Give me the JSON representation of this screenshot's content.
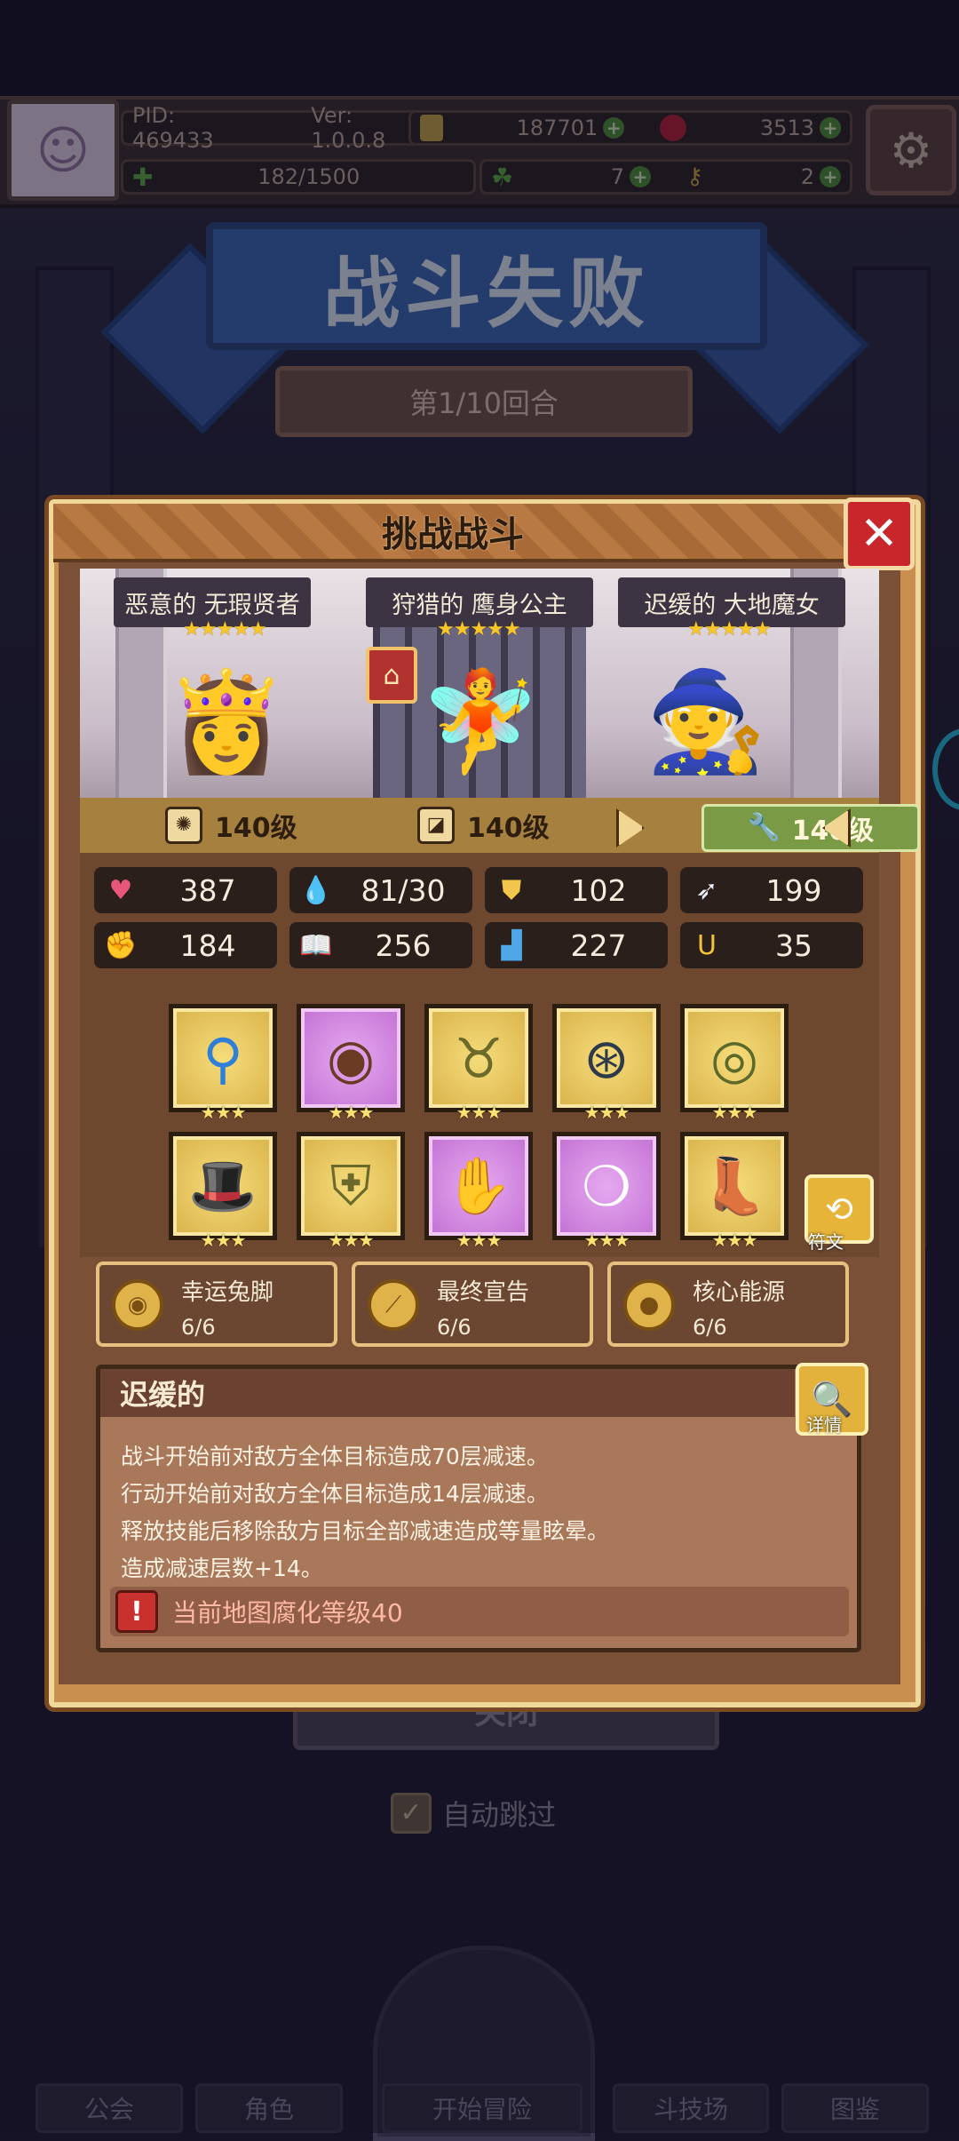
{
  "topbar": {
    "pid": "PID: 469433",
    "version": "Ver: 1.0.0.8",
    "gold": "187701",
    "gems": "3513",
    "stamina": "182/1500",
    "clover": "7",
    "key": "2"
  },
  "background": {
    "result_title": "战斗失败",
    "round": "第1/10回合",
    "close_label": "关闭",
    "auto_skip_label": "自动跳过",
    "nav": [
      "公会",
      "角色",
      "开始冒险",
      "斗技场",
      "图鉴"
    ]
  },
  "dialog": {
    "title": "挑战战斗",
    "heroes": [
      {
        "name": "恶意的 无瑕贤者",
        "stars": "★★★★★",
        "icon": "sage-portrait"
      },
      {
        "name": "狩猎的 鹰身公主",
        "stars": "★★★★★",
        "icon": "harpy-portrait"
      },
      {
        "name": "迟缓的 大地魔女",
        "stars": "★★★★★",
        "icon": "witch-portrait"
      }
    ],
    "levels": [
      "140级",
      "140级",
      "140级"
    ],
    "stats": {
      "hp": "387",
      "mana": "81/30",
      "defense": "102",
      "speed": "199",
      "attack": "184",
      "magic": "256",
      "resist": "227",
      "luck": "35"
    },
    "equipment": [
      {
        "icon": "staff-icon",
        "rarity": "gold",
        "stars": "★★★"
      },
      {
        "icon": "shield-icon",
        "rarity": "purple",
        "stars": "★★★"
      },
      {
        "icon": "necklace-icon",
        "rarity": "gold",
        "stars": "★★★"
      },
      {
        "icon": "amulet-icon",
        "rarity": "gold",
        "stars": "★★★"
      },
      {
        "icon": "ring-icon",
        "rarity": "gold",
        "stars": "★★★"
      },
      {
        "icon": "hat-icon",
        "rarity": "gold",
        "stars": "★★★"
      },
      {
        "icon": "armor-icon",
        "rarity": "gold",
        "stars": "★★★"
      },
      {
        "icon": "glove-icon",
        "rarity": "purple",
        "stars": "★★★"
      },
      {
        "icon": "belt-icon",
        "rarity": "purple",
        "stars": "★★★"
      },
      {
        "icon": "boots-icon",
        "rarity": "gold",
        "stars": "★★★"
      }
    ],
    "rune_label": "符文",
    "sets": [
      {
        "name": "幸运兔脚",
        "count": "6/6"
      },
      {
        "name": "最终宣告",
        "count": "6/6"
      },
      {
        "name": "核心能源",
        "count": "6/6"
      }
    ],
    "affix_title": "迟缓的",
    "detail_label": "详情",
    "desc_lines": [
      "战斗开始前对敌方全体目标造成70层减速。",
      "行动开始前对敌方全体目标造成14层减速。",
      "释放技能后移除敌方目标全部减速造成等量眩晕。",
      "造成减速层数+14。"
    ],
    "warning": "当前地图腐化等级40"
  },
  "colors": {
    "dialog_frame": "#c98f4f",
    "close_red": "#c9262b",
    "gold_item": "#d9b24a",
    "purple_item": "#c270d3"
  }
}
